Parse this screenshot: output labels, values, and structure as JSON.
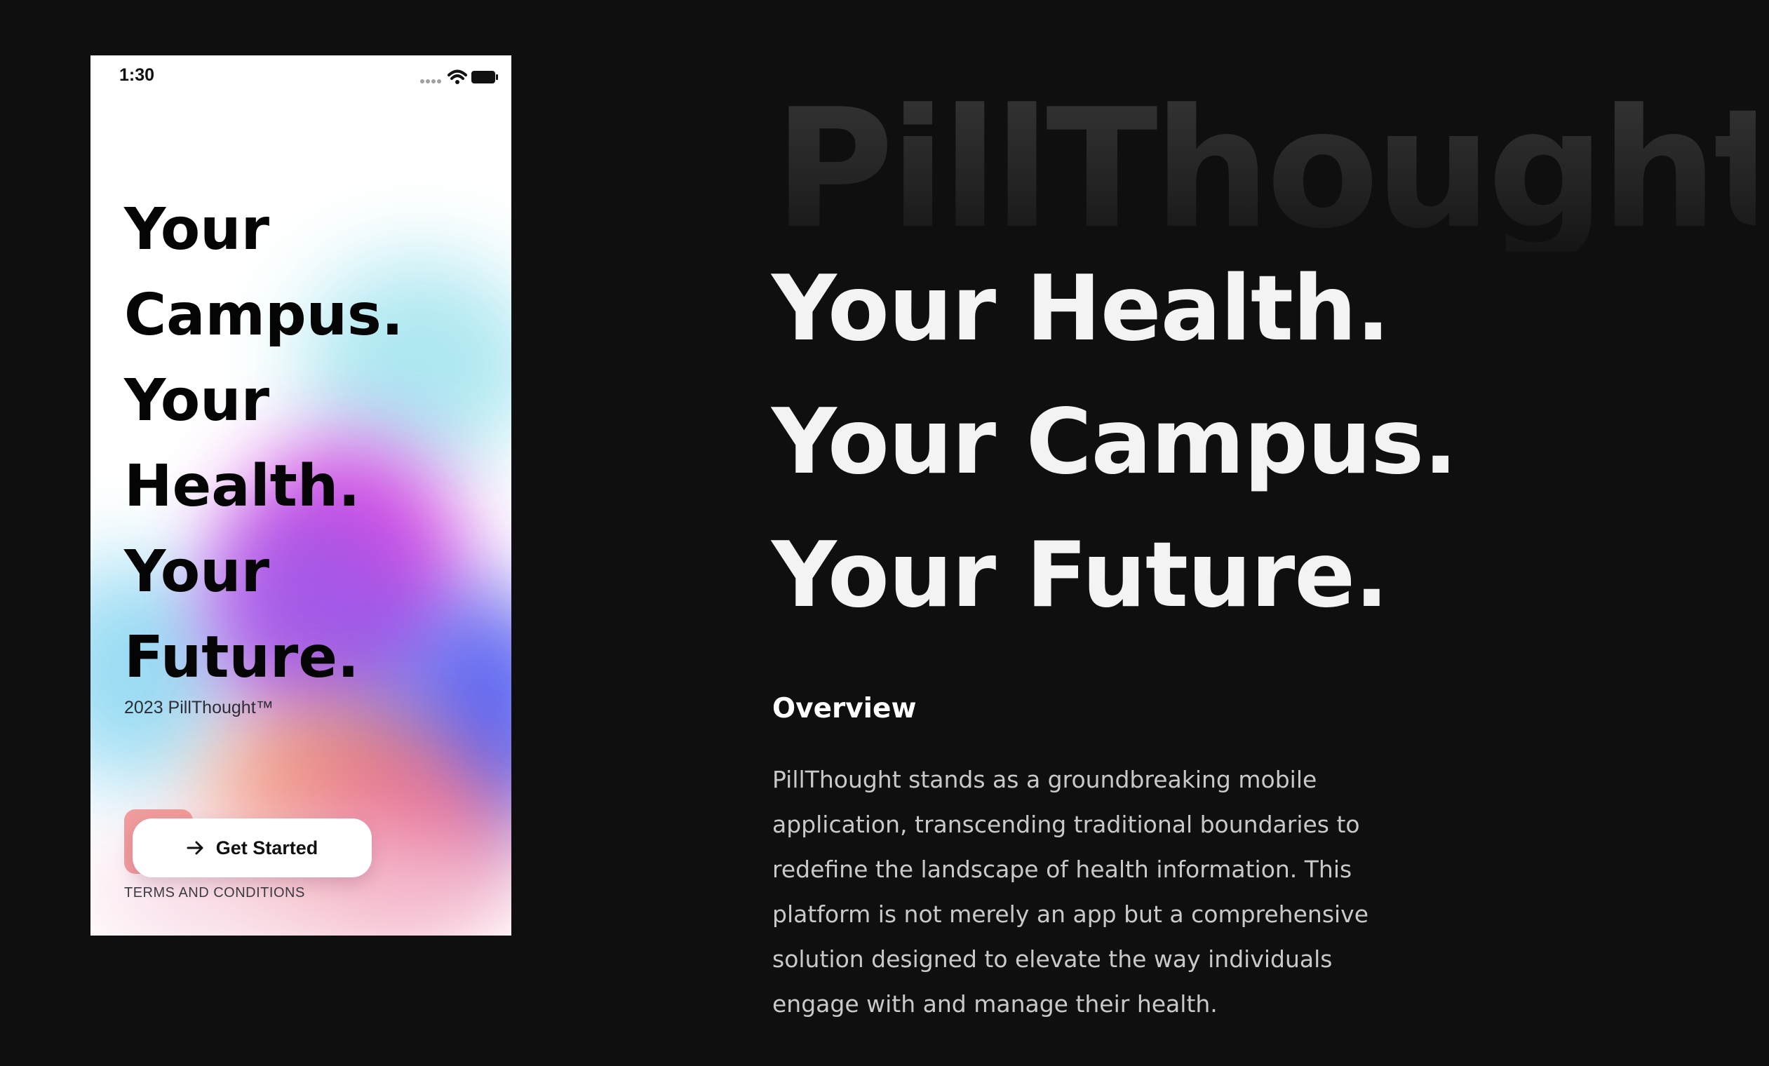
{
  "phone": {
    "status_time": "1:30",
    "status_icons": [
      "signal-dots-icon",
      "wifi-icon",
      "battery-icon"
    ],
    "headline_lines": [
      "Your",
      "Campus.",
      "Your",
      "Health.",
      "Your",
      "Future."
    ],
    "copyright": "2023 PillThought™",
    "cta": {
      "label": "Get Started",
      "icon": "arrow-right-icon"
    },
    "terms": "TERMS AND CONDITIONS",
    "gradient_colors": [
      "#a9e6f0",
      "#d63fe0",
      "#5a63f0",
      "#f08a6a",
      "#ea5f8a"
    ]
  },
  "brand": {
    "watermark": "PillThought"
  },
  "hero": {
    "lines": [
      "Your Health.",
      "Your Campus.",
      "Your Future."
    ]
  },
  "overview": {
    "title": "Overview",
    "body": "PillThought stands as a groundbreaking mobile application, transcending traditional boundaries to redefine the landscape of health information. This platform is not merely an app but a comprehensive solution designed to elevate the way individuals engage with and manage their health."
  },
  "colors": {
    "page_background": "#0f0f0f",
    "hero_text": "#f3f3f3",
    "body_text": "#c9c9c9",
    "phone_text": "#050505"
  }
}
